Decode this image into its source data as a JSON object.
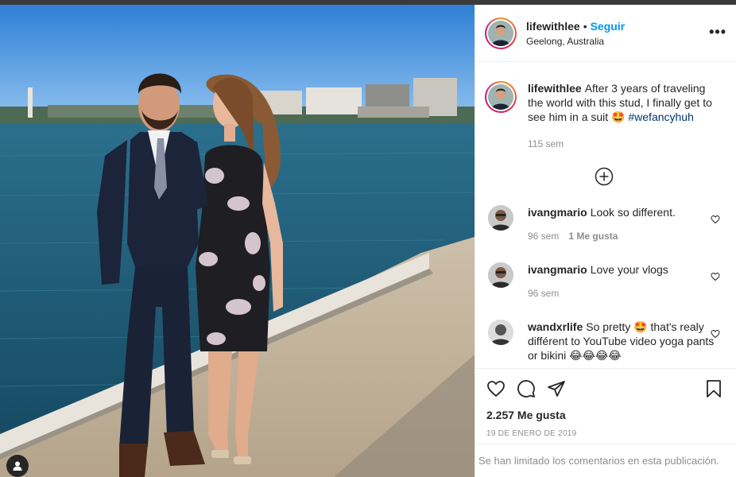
{
  "post": {
    "username": "lifewithlee",
    "separator": "•",
    "follow_label": "Seguir",
    "location": "Geelong, Australia",
    "more_label": "•••",
    "caption": "After 3 years of traveling the world with this stud, I finally get to see him in a suit 🤩",
    "hashtag": "#wefancyhuh",
    "caption_time": "115 sem",
    "likes": "2.257 Me gusta",
    "date": "19 DE ENERO DE 2019",
    "comments_limited": "Se han limitado los comentarios en esta publicación."
  },
  "comments": [
    {
      "username": "ivangmario",
      "text": "Look so different.",
      "time": "96 sem",
      "likes": "1 Me gusta"
    },
    {
      "username": "ivangmario",
      "text": "Love your vlogs",
      "time": "96 sem",
      "likes": ""
    },
    {
      "username": "wandxrlife",
      "text": "So pretty 🤩 that's realy différent to YouTube video yoga pants or bikini 😂😂😂😂",
      "time": "",
      "likes": ""
    }
  ],
  "icons": {
    "more": "more-options-icon",
    "load_more": "plus-circle-icon",
    "like": "heart-icon",
    "comment": "comment-bubble-icon",
    "share": "paper-plane-icon",
    "save": "bookmark-icon",
    "tag": "user-tag-icon"
  },
  "colors": {
    "accent": "#0095f6",
    "muted": "#8e8e8e",
    "hashtag": "#00376b",
    "border": "#efefef"
  }
}
